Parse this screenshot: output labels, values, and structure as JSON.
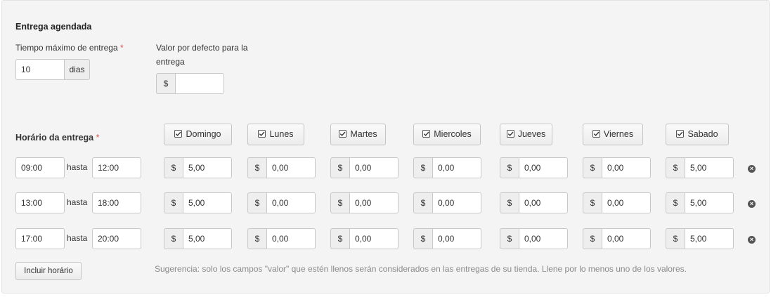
{
  "section_title": "Entrega agendada",
  "max_time": {
    "label": "Tiempo máximo de entrega",
    "required_mark": "*",
    "value": "10",
    "unit": "dias"
  },
  "default_value": {
    "label_line1": "Valor por defecto para la",
    "label_line2": "entrega",
    "currency": "$",
    "value": ""
  },
  "schedule": {
    "label": "Horário da entrega",
    "required_mark": "*",
    "days": [
      "Domingo",
      "Lunes",
      "Martes",
      "Miercoles",
      "Jueves",
      "Viernes",
      "Sabado"
    ],
    "hasta_label": "hasta",
    "currency": "$",
    "rows": [
      {
        "from": "09:00",
        "to": "12:00",
        "values": [
          "5,00",
          "0,00",
          "0,00",
          "0,00",
          "0,00",
          "0,00",
          "5,00"
        ]
      },
      {
        "from": "13:00",
        "to": "18:00",
        "values": [
          "5,00",
          "0,00",
          "0,00",
          "0,00",
          "0,00",
          "0,00",
          "5,00"
        ]
      },
      {
        "from": "17:00",
        "to": "20:00",
        "values": [
          "5,00",
          "0,00",
          "0,00",
          "0,00",
          "0,00",
          "0,00",
          "5,00"
        ]
      }
    ]
  },
  "add_button_label": "Incluir horário",
  "hint": "Sugerencia: solo los campos \"valor\" que estén llenos serán considerados en las entregas de su tienda. Llene por lo menos uno de los valores."
}
